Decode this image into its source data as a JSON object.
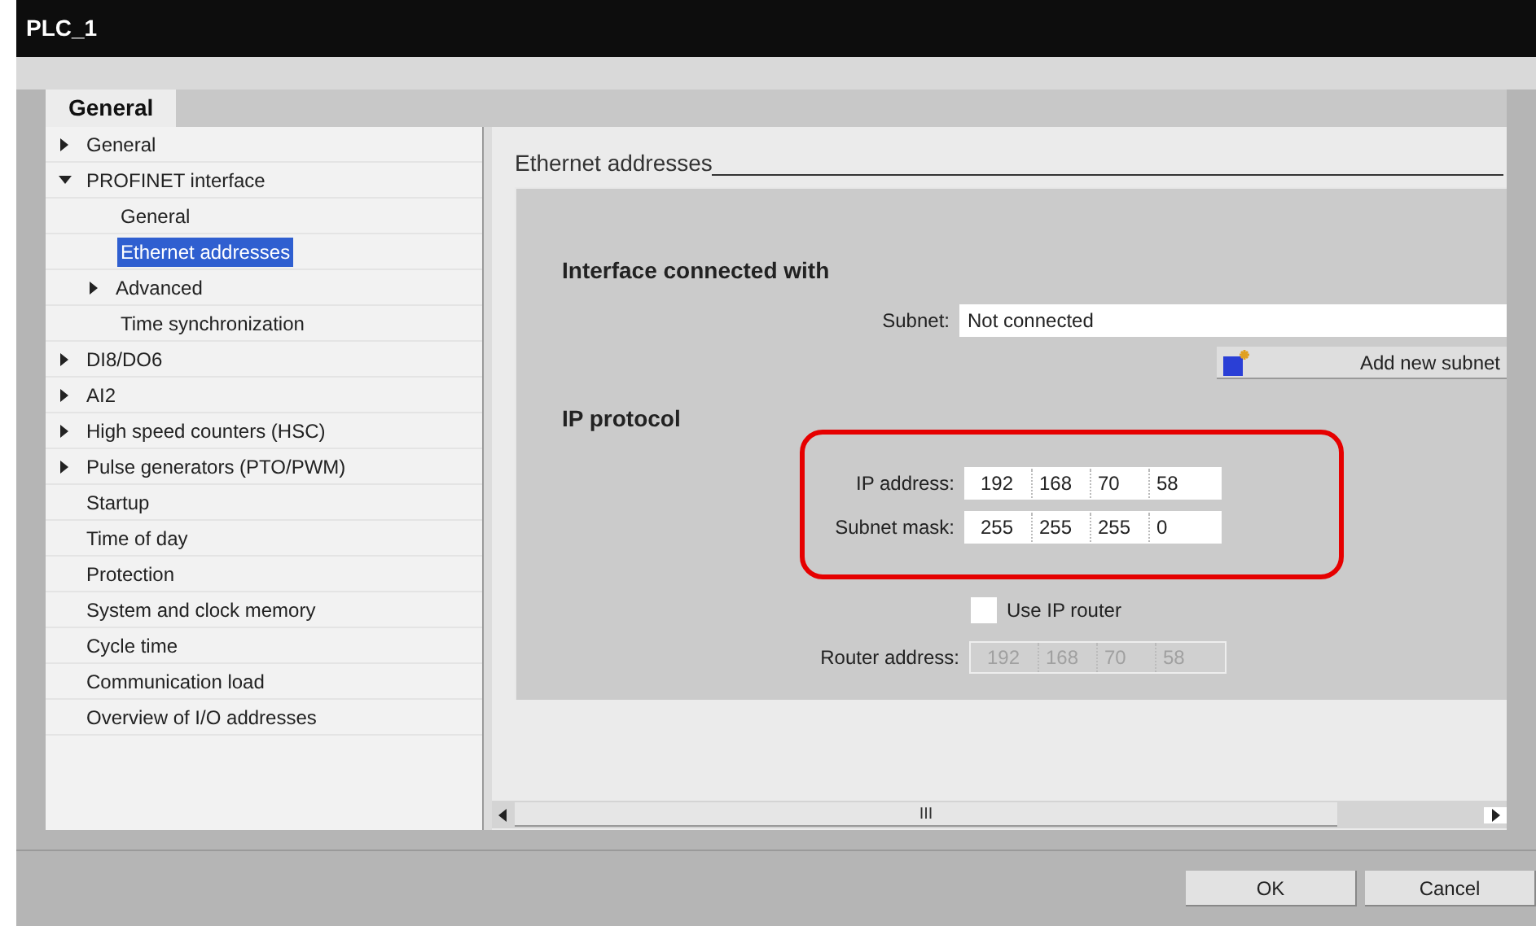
{
  "window": {
    "title": "PLC_1"
  },
  "tabs": [
    {
      "label": "General",
      "selected": true
    }
  ],
  "tree": [
    {
      "label": "General",
      "expanded": false,
      "selected": false
    },
    {
      "label": "PROFINET interface",
      "expanded": true,
      "selected": false,
      "children": [
        {
          "label": "General",
          "selected": false
        },
        {
          "label": "Ethernet addresses",
          "selected": true
        },
        {
          "label": "Advanced",
          "expanded": false,
          "selected": false
        },
        {
          "label": "Time synchronization",
          "selected": false
        }
      ]
    },
    {
      "label": "DI8/DO6",
      "expanded": false,
      "selected": false
    },
    {
      "label": "AI2",
      "expanded": false,
      "selected": false
    },
    {
      "label": "High speed counters (HSC)",
      "expanded": false,
      "selected": false
    },
    {
      "label": "Pulse generators (PTO/PWM)",
      "expanded": false,
      "selected": false
    },
    {
      "label": "Startup",
      "selected": false
    },
    {
      "label": "Time of day",
      "selected": false
    },
    {
      "label": "Protection",
      "selected": false
    },
    {
      "label": "System and clock memory",
      "selected": false
    },
    {
      "label": "Cycle time",
      "selected": false
    },
    {
      "label": "Communication load",
      "selected": false
    },
    {
      "label": "Overview of I/O addresses",
      "selected": false
    }
  ],
  "section": {
    "title": "Ethernet addresses",
    "interface": {
      "heading": "Interface connected with",
      "subnet_label": "Subnet:",
      "subnet_value": "Not connected",
      "add_button": "Add new subnet"
    },
    "ip": {
      "heading": "IP protocol",
      "highlighted": [
        {
          "label": "IP address:",
          "octets": [
            "192",
            "168",
            "70",
            "58"
          ],
          "disabled": false
        },
        {
          "label": "Subnet mask:",
          "octets": [
            "255",
            "255",
            "255",
            "0"
          ],
          "disabled": false
        }
      ],
      "router_checkbox": {
        "label": "Use IP router",
        "checked": false
      },
      "router": {
        "label": "Router address:",
        "octets": [
          "192",
          "168",
          "70",
          "58"
        ],
        "disabled": true
      }
    }
  },
  "scrollbar": {
    "grip": "III"
  },
  "buttons": [
    "OK",
    "Cancel"
  ]
}
